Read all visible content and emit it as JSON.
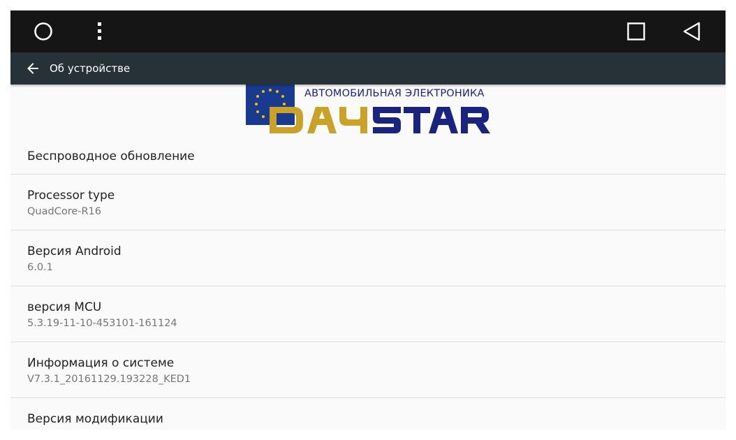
{
  "navbar": {
    "home_icon": "circle-home-icon",
    "menu_icon": "vertical-dots-menu-icon",
    "recents_icon": "square-recents-icon",
    "back_icon": "triangle-back-icon"
  },
  "toolbar": {
    "back_icon": "arrow-left-icon",
    "title": "Об устройстве"
  },
  "logo": {
    "tagline": "АВТОМОБИЛЬНАЯ ЭЛЕКТРОНИКА",
    "brand": "DAYSTAR"
  },
  "settings": [
    {
      "title": "Беспроводное обновление"
    },
    {
      "title": "Processor type",
      "value": "QuadCore-R16"
    },
    {
      "title": "Версия Android",
      "value": "6.0.1"
    },
    {
      "title": "версия MCU",
      "value": "5.3.19-11-10-453101-161124"
    },
    {
      "title": "Информация о системе",
      "value": "V7.3.1_20161129.193228_KED1"
    },
    {
      "title": "Версия модификации"
    }
  ],
  "colors": {
    "navbar_bg": "#151515",
    "toolbar_bg": "#263238",
    "content_bg": "#fafafa",
    "logo_gold": "#c9a227",
    "logo_navy": "#1a237e"
  }
}
